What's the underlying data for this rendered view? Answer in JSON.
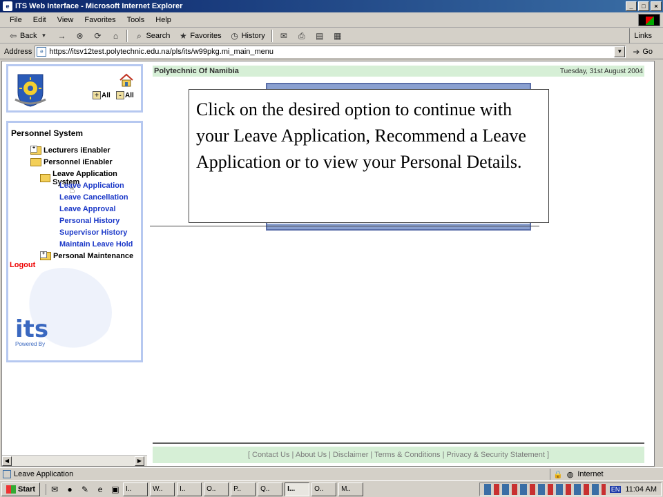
{
  "window": {
    "title": "ITS Web Interface - Microsoft Internet Explorer",
    "min": "_",
    "max": "□",
    "close": "×"
  },
  "menu": [
    "File",
    "Edit",
    "View",
    "Favorites",
    "Tools",
    "Help"
  ],
  "toolbar": {
    "back": "Back",
    "forward": "→",
    "stop": "⊗",
    "refresh": "⟳",
    "home": "⌂",
    "search": "Search",
    "favorites": "Favorites",
    "history": "History",
    "links": "Links"
  },
  "address": {
    "label": "Address",
    "url": "https://itsv12test.polytechnic.edu.na/pls/its/w99pkg.mi_main_menu",
    "go": "Go"
  },
  "logo_panel": {
    "all1": "All",
    "all2": "All"
  },
  "nav": {
    "title": "Personnel System",
    "items": [
      {
        "label": "Lecturers iEnabler"
      },
      {
        "label": "Personnel iEnabler"
      },
      {
        "label": "Leave Application System"
      },
      {
        "label": "Leave Application"
      },
      {
        "label": "Leave Cancellation"
      },
      {
        "label": "Leave Approval"
      },
      {
        "label": "Personal History"
      },
      {
        "label": "Supervisor History"
      },
      {
        "label": "Maintain Leave Hold"
      },
      {
        "label": "Personal Maintenance"
      }
    ],
    "logout": "Logout",
    "logo_text": "its",
    "powered": "Powered By"
  },
  "main": {
    "org_name": "Polytechnic Of Namibia",
    "date": "Tuesday, 31st August 2004",
    "tooltip": "Click on the desired option to continue with your Leave Application, Recommend a Leave Application or to view your Personal Details.",
    "footer": "[ Contact Us | About Us | Disclaimer | Terms & Conditions | Privacy & Security Statement ]"
  },
  "status": {
    "text": "Leave Application",
    "zone": "Internet"
  },
  "taskbar": {
    "start": "Start",
    "tasks": [
      "I..",
      "W..",
      "I..",
      "O..",
      "P..",
      "Q..",
      "I...",
      "O..",
      "M.."
    ],
    "lang": "EN",
    "clock": "11:04 AM"
  }
}
